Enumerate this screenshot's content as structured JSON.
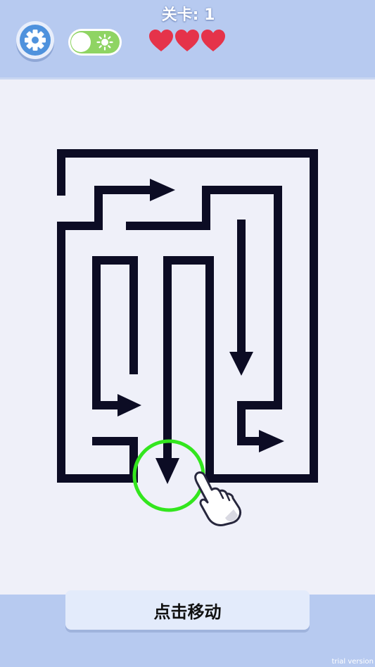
{
  "header": {
    "level_label": "关卡: 1",
    "lives": 3
  },
  "button": {
    "label": "点击移动"
  },
  "watermark": "trial version",
  "colors": {
    "top_bar": "#b7caf0",
    "background": "#eff0f9",
    "maze_wall": "#0c0c24",
    "ring": "#33e61e",
    "heart": "#e5334a",
    "toggle_on": "#8fd463",
    "settings": "#4f92dd"
  },
  "icons": [
    "gear-icon",
    "sun-icon",
    "heart-icon",
    "pointing-hand-icon",
    "arrow-icon"
  ]
}
